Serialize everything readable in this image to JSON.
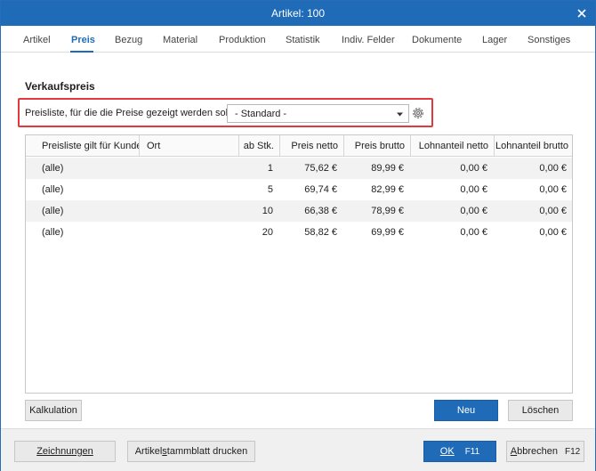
{
  "window": {
    "title": "Artikel: 100"
  },
  "tabs": [
    {
      "label": "Artikel"
    },
    {
      "label": "Preis",
      "active": true
    },
    {
      "label": "Bezug"
    },
    {
      "label": "Material"
    },
    {
      "label": "Produktion"
    },
    {
      "label": "Statistik"
    },
    {
      "label": "Indiv. Felder"
    },
    {
      "label": "Dokumente"
    },
    {
      "label": "Lager"
    },
    {
      "label": "Sonstiges"
    }
  ],
  "section": {
    "title": "Verkaufspreis"
  },
  "pricelist": {
    "label": "Preisliste, für die die Preise gezeigt werden sollen:",
    "selected": "- Standard -"
  },
  "table": {
    "columns": [
      "Preisliste gilt für Kunde",
      "Ort",
      "ab Stk.",
      "Preis netto",
      "Preis brutto",
      "Lohnanteil netto",
      "Lohnanteil brutto"
    ],
    "rows": [
      [
        "(alle)",
        "",
        "1",
        "75,62 €",
        "89,99 €",
        "0,00 €",
        "0,00 €"
      ],
      [
        "(alle)",
        "",
        "5",
        "69,74 €",
        "82,99 €",
        "0,00 €",
        "0,00 €"
      ],
      [
        "(alle)",
        "",
        "10",
        "66,38 €",
        "78,99 €",
        "0,00 €",
        "0,00 €"
      ],
      [
        "(alle)",
        "",
        "20",
        "58,82 €",
        "69,99 €",
        "0,00 €",
        "0,00 €"
      ]
    ]
  },
  "buttons": {
    "kalkulation": "Kalkulation",
    "neu": "Neu",
    "loeschen": "Löschen",
    "zeichnungen": "Zeichnungen",
    "stammblatt_pre": "Artikel",
    "stammblatt_u": "s",
    "stammblatt_post": "tammblatt drucken",
    "ok": "OK",
    "ok_shortcut": "F11",
    "abbrechen_u": "A",
    "abbrechen_post": "bbrechen",
    "abbrechen_shortcut": "F12"
  },
  "colors": {
    "accent": "#1f6bb8",
    "highlight": "#e0393e",
    "row_alt": "#f2f2f2"
  }
}
